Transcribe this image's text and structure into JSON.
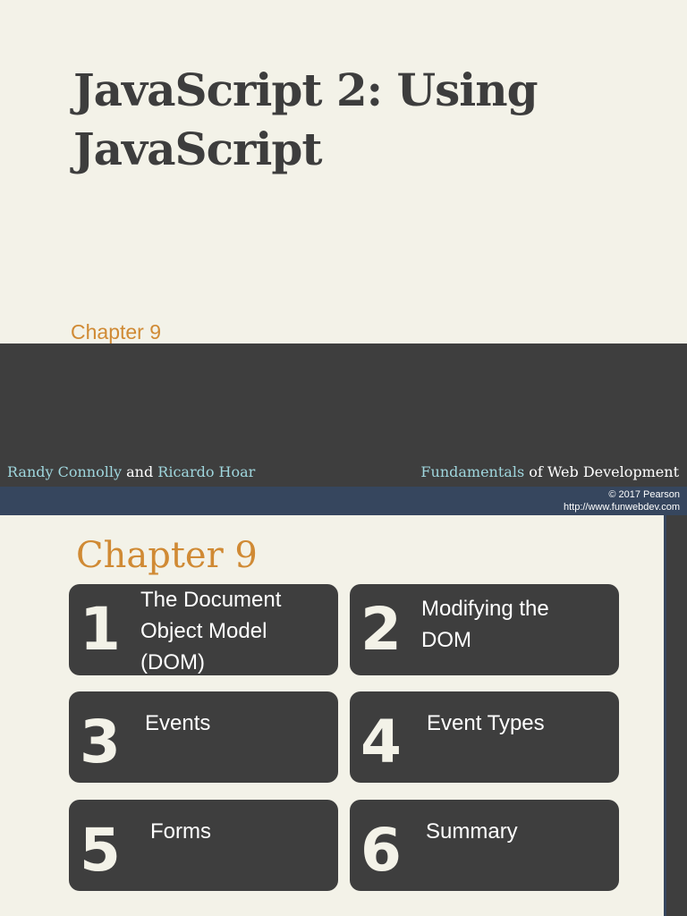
{
  "title": "JavaScript 2: Using JavaScript",
  "chapter_label": "Chapter 9",
  "authors": {
    "a1": "Randy Connolly",
    "and": " and ",
    "a2": "Ricardo Hoar"
  },
  "book": {
    "b1": "Fundamentals",
    "b2": " of Web Development"
  },
  "copyright": "© 2017 Pearson",
  "url": "http://www.funwebdev.com",
  "toc_title": "Chapter 9",
  "sections": [
    {
      "num": "1",
      "label": "The Document Object Model (DOM)"
    },
    {
      "num": "2",
      "label": "Modifying the DOM"
    },
    {
      "num": "3",
      "label": "Events"
    },
    {
      "num": "4",
      "label": "Event Types"
    },
    {
      "num": "5",
      "label": "Forms"
    },
    {
      "num": "6",
      "label": "Summary"
    }
  ]
}
